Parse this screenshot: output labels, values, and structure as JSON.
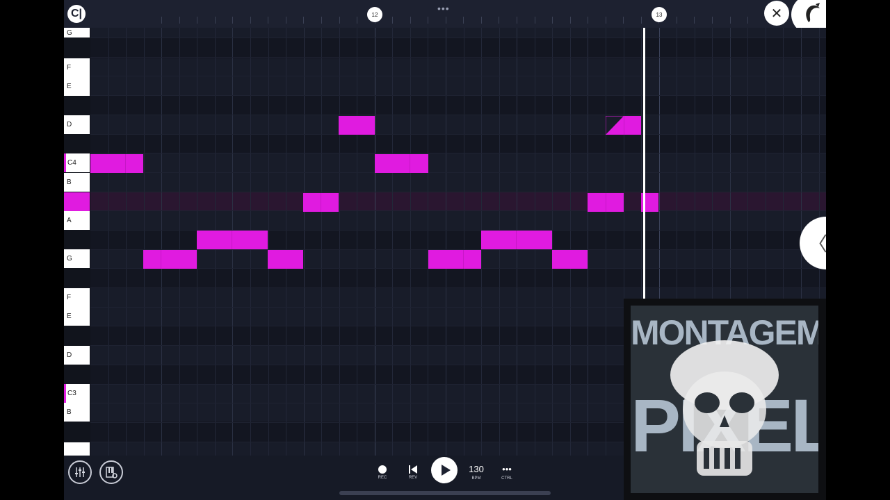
{
  "app": {
    "logo_glyph": "C|",
    "close_glyph": "✕",
    "more_glyph": "•••",
    "side_tab_glyph": "〈",
    "accent": "#e01be0"
  },
  "timeline": {
    "bar_markers": [
      "12",
      "13"
    ]
  },
  "piano_keys": [
    {
      "label": "G"
    },
    {
      "label": "F"
    },
    {
      "label": "E"
    },
    {
      "label": "D"
    },
    {
      "label": "C4"
    },
    {
      "label": "B"
    },
    {
      "label": ""
    },
    {
      "label": "A"
    },
    {
      "label": "G"
    },
    {
      "label": "F"
    },
    {
      "label": "E"
    },
    {
      "label": "D"
    },
    {
      "label": "C3"
    },
    {
      "label": "B"
    }
  ],
  "transport": {
    "rec_label": "REC",
    "rev_label": "REV",
    "bpm_value": "130",
    "bpm_label": "BPM",
    "ctrl_label": "CTRL",
    "ctrl_glyph": "•••"
  },
  "overlay": {
    "line1": "MONTAGEM",
    "line2": "PIXELS"
  }
}
